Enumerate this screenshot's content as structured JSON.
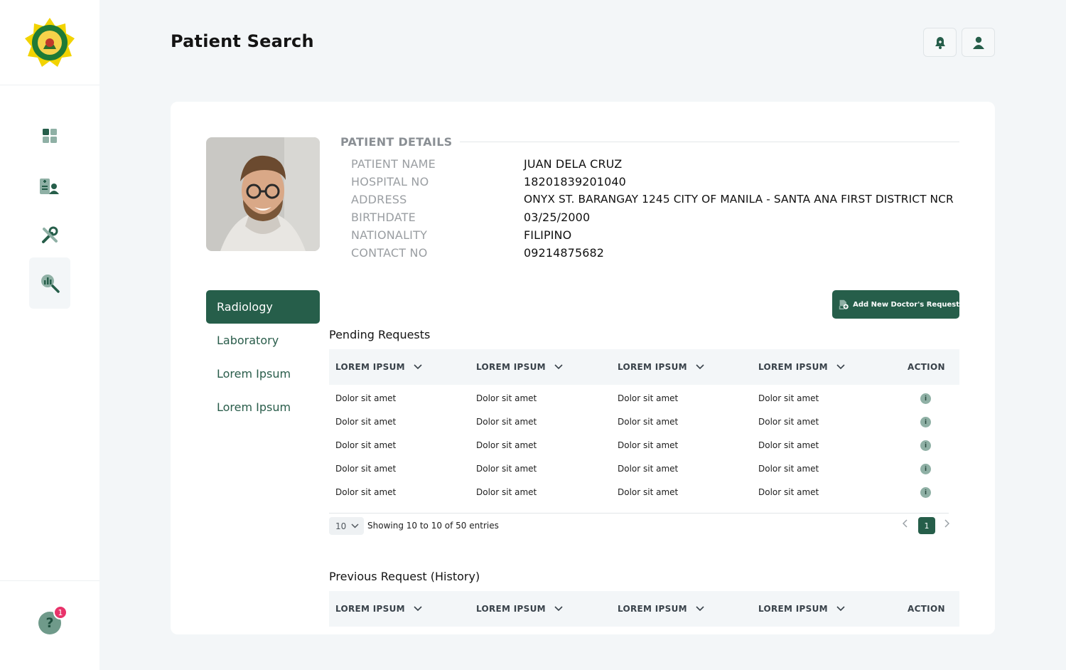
{
  "header": {
    "title": "Patient Search"
  },
  "sidebar": {
    "items": [
      {
        "name": "dashboard"
      },
      {
        "name": "patients"
      },
      {
        "name": "tools"
      },
      {
        "name": "search-analytics"
      }
    ],
    "help_badge": "1",
    "help_icon": "?"
  },
  "patient": {
    "section_label": "PATIENT DETAILS",
    "fields": [
      {
        "label": "PATIENT NAME",
        "value": "JUAN DELA CRUZ"
      },
      {
        "label": "HOSPITAL NO",
        "value": "18201839201040"
      },
      {
        "label": "ADDRESS",
        "value": "ONYX ST.  BARANGAY 1245 CITY OF MANILA - SANTA ANA FIRST DISTRICT NCR"
      },
      {
        "label": "BIRTHDATE",
        "value": "03/25/2000"
      },
      {
        "label": "NATIONALITY",
        "value": "FILIPINO"
      },
      {
        "label": "CONTACT NO",
        "value": "09214875682"
      }
    ]
  },
  "tabs": [
    {
      "label": "Radiology",
      "active": true
    },
    {
      "label": "Laboratory"
    },
    {
      "label": "Lorem Ipsum"
    },
    {
      "label": "Lorem Ipsum"
    }
  ],
  "add_request_label": "Add New Doctor's Request",
  "pending": {
    "title": "Pending Requests",
    "columns": [
      "LOREM IPSUM",
      "LOREM IPSUM",
      "LOREM IPSUM",
      "LOREM IPSUM",
      "ACTION"
    ],
    "rows": [
      [
        "Dolor sit amet",
        "Dolor sit amet",
        "Dolor sit amet",
        "Dolor sit amet"
      ],
      [
        "Dolor sit amet",
        "Dolor sit amet",
        "Dolor sit amet",
        "Dolor sit amet"
      ],
      [
        "Dolor sit amet",
        "Dolor sit amet",
        "Dolor sit amet",
        "Dolor sit amet"
      ],
      [
        "Dolor sit amet",
        "Dolor sit amet",
        "Dolor sit amet",
        "Dolor sit amet"
      ],
      [
        "Dolor sit amet",
        "Dolor sit amet",
        "Dolor sit amet",
        "Dolor sit amet"
      ]
    ],
    "action_icon": "i",
    "per_page": "10",
    "showing": "Showing 10 to 10 of 50 entries",
    "current_page": "1"
  },
  "history": {
    "title": "Previous Request (History)",
    "columns": [
      "LOREM IPSUM",
      "LOREM IPSUM",
      "LOREM IPSUM",
      "LOREM IPSUM",
      "ACTION"
    ]
  },
  "colors": {
    "primary": "#265e4a",
    "badge": "#e8336a",
    "background": "#f3f6f8"
  }
}
